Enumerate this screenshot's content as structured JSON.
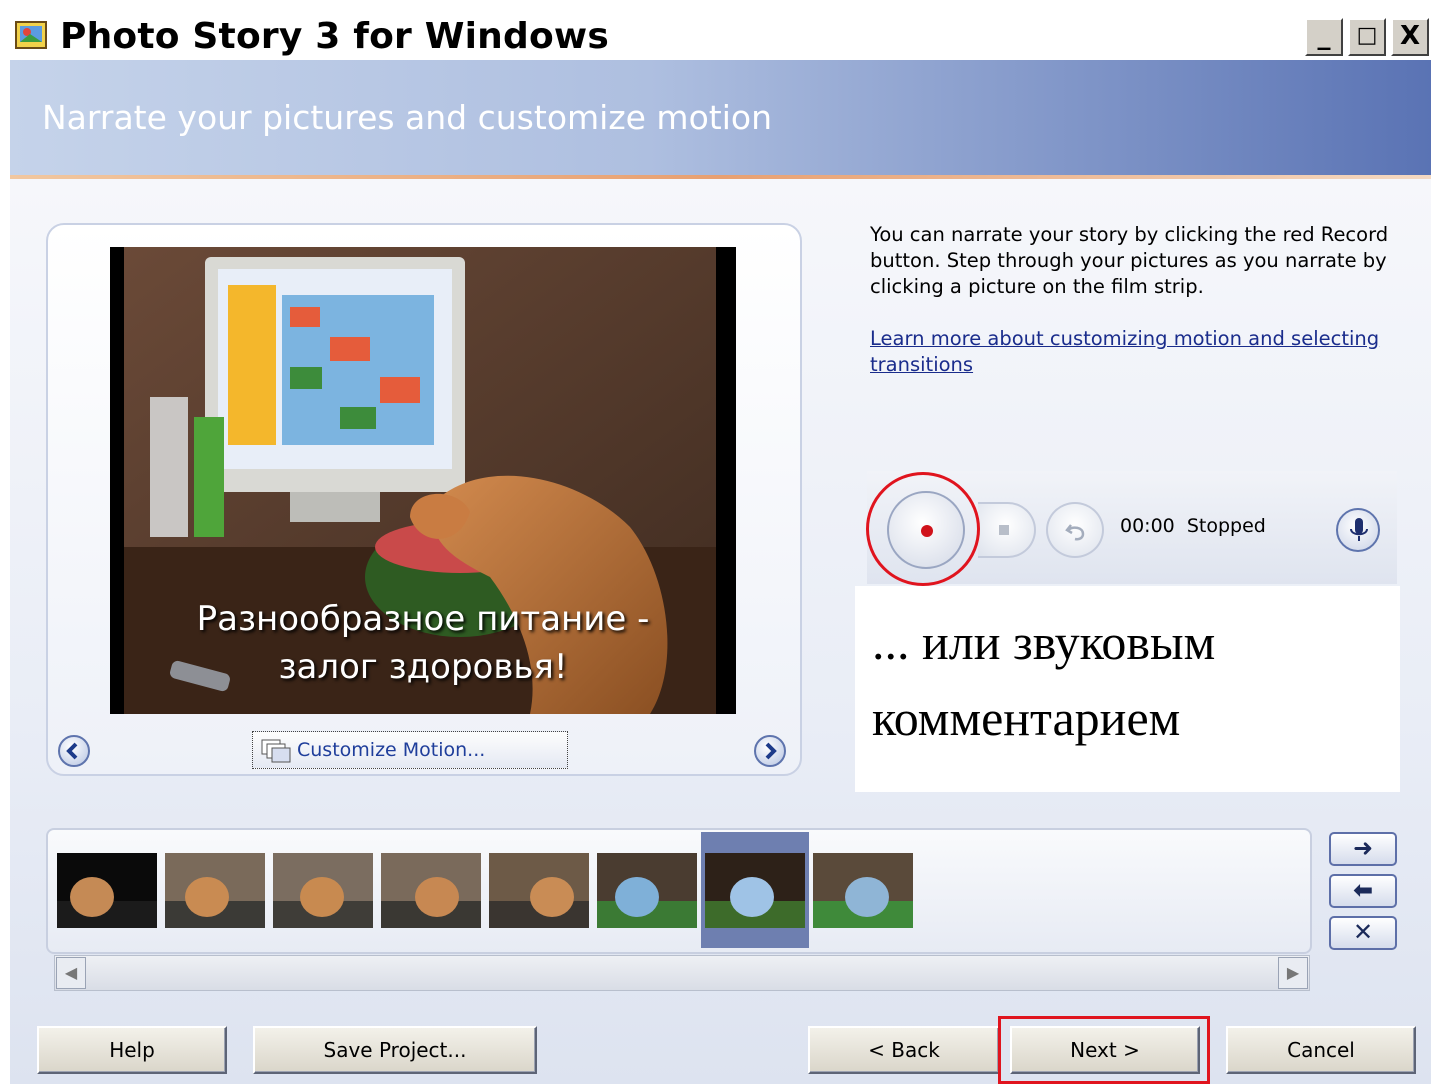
{
  "window": {
    "title": "Photo Story 3 for Windows",
    "controls": [
      "_",
      "□",
      "X"
    ]
  },
  "header": {
    "title": "Narrate your pictures and customize motion"
  },
  "preview": {
    "caption_line1": "Разнообразное питание -",
    "caption_line2": "залог здоровья!",
    "customize_label": "Customize Motion..."
  },
  "info": {
    "text": "You can narrate your story by clicking the red Record button. Step through your pictures as you narrate by clicking a picture on the film strip.",
    "link": "Learn more about customizing motion and selecting transitions"
  },
  "recorder": {
    "time": "00:00",
    "status": "Stopped"
  },
  "annotation": {
    "line1": "... или звуковым",
    "line2": "комментарием"
  },
  "filmstrip": {
    "thumb_count": 8,
    "selected_index": 6,
    "side_buttons": [
      "➜",
      "⬅",
      "✕"
    ]
  },
  "buttons": {
    "help": "Help",
    "save": "Save Project...",
    "back": "< Back",
    "next": "Next >",
    "cancel": "Cancel"
  },
  "colors": {
    "highlight_red": "#e0141e",
    "link_blue": "#1a2c8c"
  }
}
